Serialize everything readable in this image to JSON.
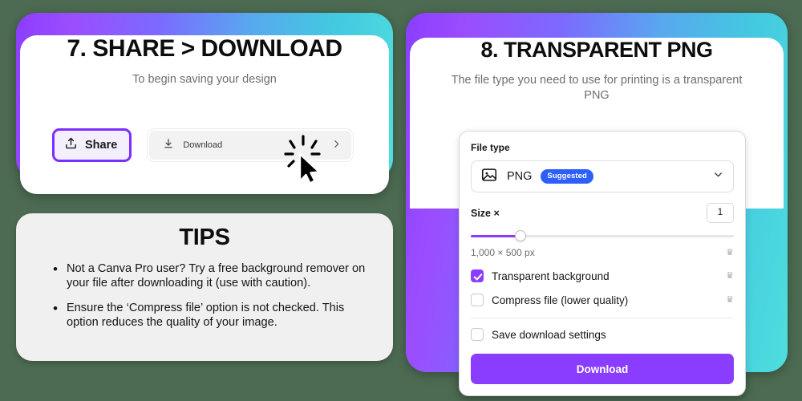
{
  "backdrop_color": "#4c6b52",
  "accent_purple": "#8b3dff",
  "accent_cyan": "#4fdede",
  "badge_blue": "#2d5fff",
  "cards": {
    "share": {
      "title": "7. SHARE > DOWNLOAD",
      "subtitle": "To begin saving your design",
      "share_button_label": "Share",
      "share_icon": "share-upload-icon",
      "download_row_label": "Download",
      "download_row_icon": "download-arrow-icon",
      "chevron_right_icon": "chevron-right-icon",
      "cursor_icon": "click-cursor-icon"
    },
    "png": {
      "title": "8. TRANSPARENT PNG",
      "subtitle": "The file type you need to use for printing is a transparent PNG"
    },
    "tips": {
      "title": "TIPS",
      "items": [
        "Not a Canva Pro user? Try a free background remover on your file after downloading it (use with caution).",
        "Ensure the ‘Compress file’ option is not checked. This option reduces the quality of your image."
      ],
      "bullet": "•"
    }
  },
  "download_panel": {
    "file_type_label": "File type",
    "file_type_icon": "image-file-icon",
    "file_type_value": "PNG",
    "suggested_badge": "Suggested",
    "chevron_down_icon": "chevron-down-icon",
    "size_label": "Size ×",
    "size_value": "1",
    "slider_percent": "19",
    "dimensions_text": "1,000 × 500 px",
    "crown_icon": "crown-icon",
    "crown_glyph": "♛",
    "options": [
      {
        "label": "Transparent background",
        "checked": true,
        "pro": true
      },
      {
        "label": "Compress file (lower quality)",
        "checked": false,
        "pro": true
      },
      {
        "label": "Save download settings",
        "checked": false,
        "pro": false
      }
    ],
    "download_button_label": "Download"
  }
}
